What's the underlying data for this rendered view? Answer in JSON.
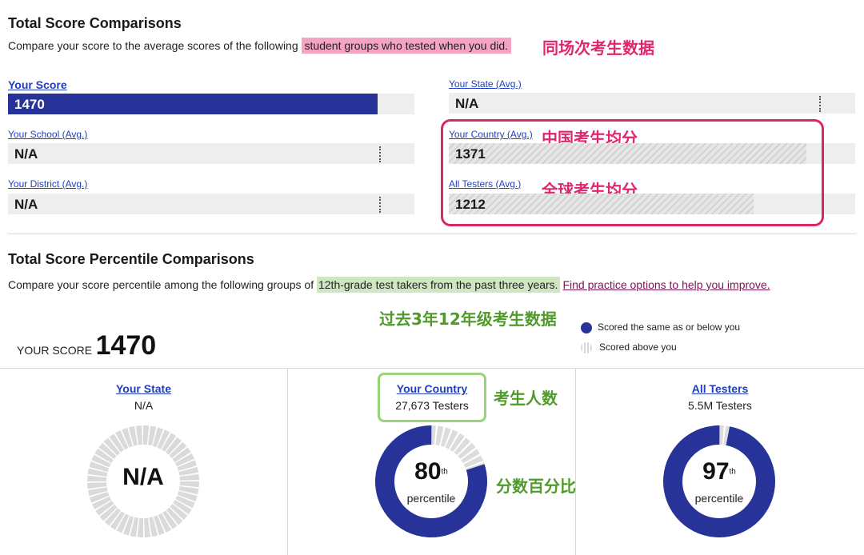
{
  "total_compare": {
    "title": "Total Score Comparisons",
    "desc_prefix": "Compare your score to the average scores of the following ",
    "desc_highlight": "student groups who tested when you did.",
    "annotation": "同场次考生数据",
    "your_score": {
      "label": "Your Score",
      "value": "1470",
      "fraction": 0.91
    },
    "your_state": {
      "label": "Your State (Avg.)",
      "value": "N/A"
    },
    "your_school": {
      "label": "Your School (Avg.)",
      "value": "N/A"
    },
    "your_country": {
      "label": "Your Country (Avg.)",
      "value": "1371",
      "fraction": 0.88,
      "annotation": "中国考生均分"
    },
    "your_district": {
      "label": "Your District (Avg.)",
      "value": "N/A"
    },
    "all_testers": {
      "label": "All Testers (Avg.)",
      "value": "1212",
      "fraction": 0.75,
      "annotation": "全球考生均分"
    }
  },
  "percentile_compare": {
    "title": "Total Score Percentile Comparisons",
    "desc_prefix": "Compare your score percentile among the following groups of ",
    "desc_highlight": "12th-grade test takers from the past three years.",
    "desc_link": "Find practice options to help you improve.",
    "annotation": "过去3年12年级考生数据",
    "legend_same": "Scored the same as or below you",
    "legend_above": "Scored above you",
    "your_score_label": "YOUR SCORE",
    "your_score_value": "1470",
    "testers_annotation": "考生人数",
    "percent_annotation": "分数百分比",
    "panels": [
      {
        "title": "Your State",
        "sub": "N/A",
        "center": "N/A",
        "percentile": null
      },
      {
        "title": "Your Country",
        "sub": "27,673 Testers",
        "center": "80",
        "sup": "th",
        "word": "percentile",
        "percentile": 80
      },
      {
        "title": "All Testers",
        "sub": "5.5M Testers",
        "center": "97",
        "sup": "th",
        "word": "percentile",
        "percentile": 97
      }
    ]
  },
  "colors": {
    "navy": "#28339a",
    "pink": "#d9275f",
    "green": "#4f9a2a"
  }
}
